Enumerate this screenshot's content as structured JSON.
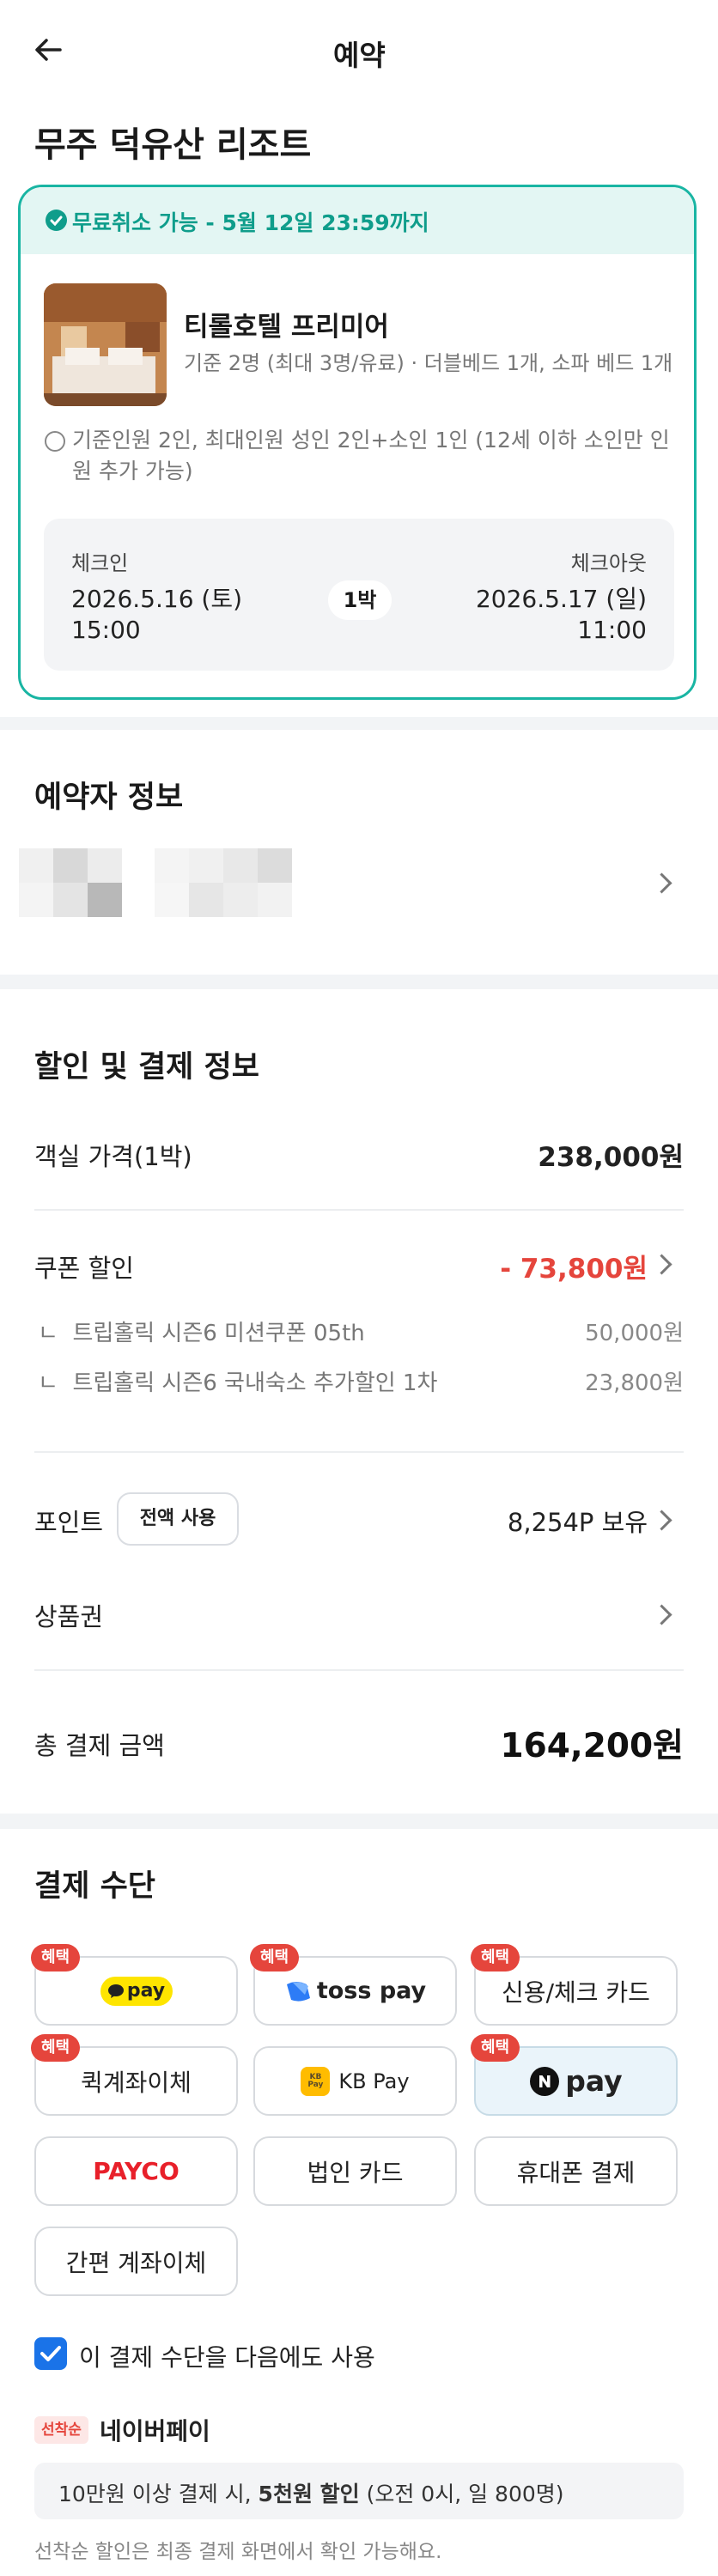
{
  "header": {
    "title": "예약"
  },
  "hotel": {
    "name": "무주 덕유산 리조트"
  },
  "card": {
    "cancel": "무료취소 가능 - 5월 12일 23:59까지",
    "room_name": "티롤호텔 프리미어",
    "room_desc": "기준 2명 (최대 3명/유료) · 더블베드 1개, 소파 베드 1개",
    "note": "기준인원 2인, 최대인원 성인 2인+소인 1인 (12세 이하 소인만 인원 추가 가능)",
    "checkin_label": "체크인",
    "checkin_date": "2026.5.16 (토)",
    "checkin_time": "15:00",
    "nights": "1박",
    "checkout_label": "체크아웃",
    "checkout_date": "2026.5.17 (일)",
    "checkout_time": "11:00"
  },
  "booker": {
    "title": "예약자 정보"
  },
  "payment_info": {
    "title": "할인 및 결제 정보",
    "room_price_label": "객실 가격(1박)",
    "room_price": "238,000원",
    "coupon_label": "쿠폰 할인",
    "coupon_value": "- 73,800원",
    "coupons": [
      {
        "label": "트립홀릭 시즌6 미션쿠폰 05th",
        "value": "50,000원"
      },
      {
        "label": "트립홀릭 시즌6 국내숙소 추가할인 1차",
        "value": "23,800원"
      }
    ],
    "point_label": "포인트",
    "point_button": "전액 사용",
    "point_value": "8,254P 보유",
    "voucher_label": "상품권",
    "total_label": "총 결제 금액",
    "total_value": "164,200원"
  },
  "methods": {
    "title": "결제 수단",
    "badge": "혜택",
    "kakao": "pay",
    "toss": "toss pay",
    "card": "신용/체크 카드",
    "quick_transfer": "퀵계좌이체",
    "kbpay": "KB Pay",
    "kb_logo": "KB Pay",
    "npay": "pay",
    "payco": "PAYCO",
    "corp_card": "법인 카드",
    "phone": "휴대폰 결제",
    "easy_transfer": "간편 계좌이체",
    "remember": "이 결제 수단을 다음에도 사용",
    "first_come": "선착순",
    "promo_title": "네이버페이",
    "promo_text_a": "10만원 이상 결제 시, ",
    "promo_text_b": "5천원 할인",
    "promo_text_c": " (오전 0시, 일 800명)",
    "footnote": "선착순 할인은 최종 결제 화면에서 확인 가능해요."
  },
  "colors": {
    "accent": "#19b5a3",
    "discount": "#e5453c",
    "badge": "#e5453c",
    "checkbox": "#1a73e8"
  }
}
